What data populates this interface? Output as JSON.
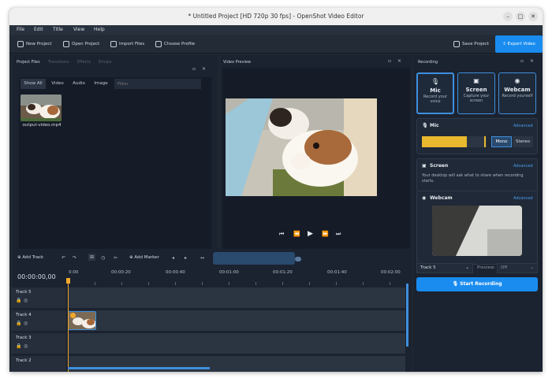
{
  "window": {
    "title": "* Untitled Project [HD 720p 30 fps] - OpenShot Video Editor",
    "minimize": "–",
    "maximize": "□",
    "close": "✕"
  },
  "menu": [
    "File",
    "Edit",
    "Title",
    "View",
    "Help"
  ],
  "toolbar": {
    "new_project": "New Project",
    "open_project": "Open Project",
    "import_files": "Import Files",
    "choose_profile": "Choose Profile",
    "save_project": "Save Project",
    "export_video": "Export Video"
  },
  "project_files": {
    "tabs": [
      "Project Files",
      "Transitions",
      "Effects",
      "Emojis"
    ],
    "filters": [
      "Show All",
      "Video",
      "Audio",
      "Image"
    ],
    "filter_placeholder": "Filter",
    "file_name": "output-video.mp4"
  },
  "preview": {
    "title": "Video Preview"
  },
  "recording": {
    "title": "Recording",
    "modes": [
      {
        "label": "Mic",
        "sub": "Record your voice"
      },
      {
        "label": "Screen",
        "sub": "Capture your screen"
      },
      {
        "label": "Webcam",
        "sub": "Record yourself"
      }
    ],
    "mic": {
      "title": "Mic",
      "advanced": "Advanced",
      "mono": "Mono",
      "stereo": "Stereo",
      "level": 0.7
    },
    "screen": {
      "title": "Screen",
      "advanced": "Advanced",
      "desc": "Your desktop will ask what to share when recording starts."
    },
    "webcam": {
      "title": "Webcam",
      "advanced": "Advanced"
    },
    "track_select": "Track 5",
    "preview_label": "Preview:",
    "preview_value": "Off",
    "start": "Start Recording"
  },
  "timeline": {
    "add_track": "Add Track",
    "add_marker": "Add Marker",
    "timecode": "00:00:00,00",
    "ruler": [
      "0:00",
      "00:00:20",
      "00:00:40",
      "00:01:00",
      "00:01:20",
      "00:01:40",
      "00:02:00"
    ],
    "tracks": [
      "Track 5",
      "Track 4",
      "Track 3",
      "Track 2"
    ]
  },
  "colors": {
    "accent": "#1a8cf0",
    "playhead": "#f0a92c",
    "level": "#e8b82e"
  }
}
